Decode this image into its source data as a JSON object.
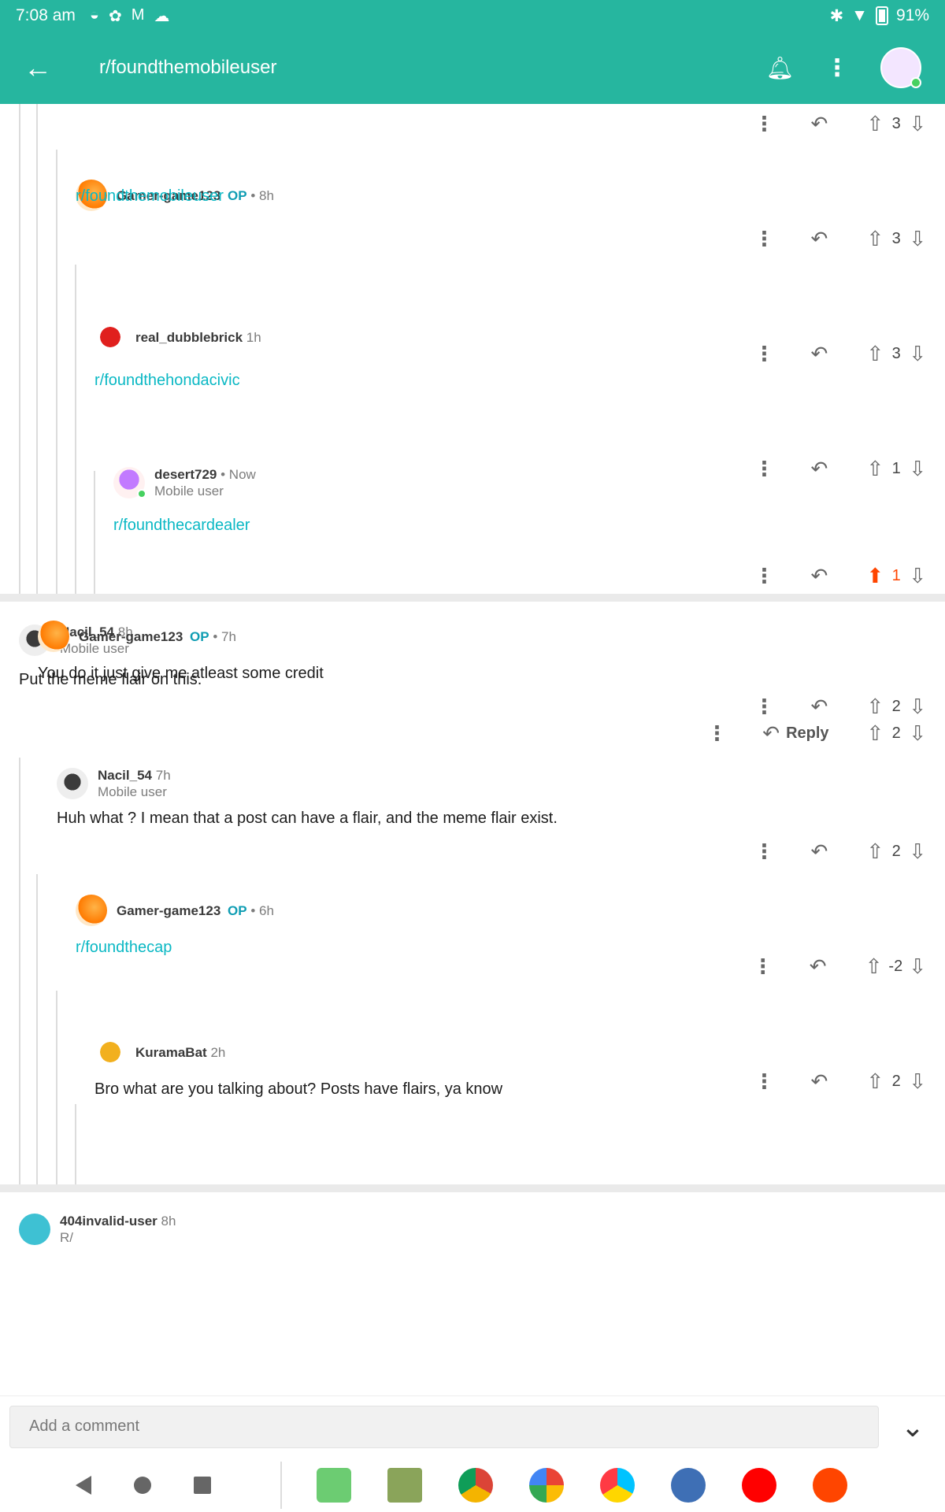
{
  "status_bar": {
    "time": "7:08 am",
    "battery": "91%",
    "icons": [
      "food-icon",
      "ip-icon",
      "gmail-icon",
      "cloud-icon",
      "bluetooth-icon",
      "wifi-icon"
    ]
  },
  "header": {
    "title": "r/foundthemobileuser",
    "back_icon": "back-arrow-icon"
  },
  "reply_label": "Reply",
  "comments": [
    {
      "user": "Gamer-game123",
      "op": "OP",
      "time": "• 8h",
      "flair": "",
      "body": "r/foundthemobileuser",
      "score": "3",
      "link": true
    },
    {
      "user": "real_dubblebrick",
      "op": "",
      "time": "1h",
      "flair": "",
      "body": "r/foundthehondacivic",
      "score": "1",
      "link": true
    },
    {
      "user": "desert729",
      "op": "",
      "time": "• Now",
      "flair": "Mobile user",
      "body": "r/foundthecardealer",
      "score": "1",
      "link": true,
      "upvoted": true
    },
    {
      "user": "Nacil_54",
      "op": "",
      "time": "8h",
      "flair": "Mobile user",
      "body": "Put the meme flair on this.",
      "score": "2",
      "link": false
    },
    {
      "user": "Gamer-game123",
      "op": "OP",
      "time": "• 7h",
      "flair": "",
      "body": "You do it just give me atleast some credit",
      "score": "2",
      "link": false
    },
    {
      "user": "Nacil_54",
      "op": "",
      "time": "7h",
      "flair": "Mobile user",
      "body": "Huh what ? I mean that a post can have a flair, and the meme flair exist.",
      "score": "2",
      "link": false
    },
    {
      "user": "Gamer-game123",
      "op": "OP",
      "time": "• 6h",
      "flair": "",
      "body": "r/foundthecap",
      "score": "-2",
      "link": true
    },
    {
      "user": "KuramaBat",
      "op": "",
      "time": "2h",
      "flair": "",
      "body": "Bro what are you talking about? Posts have flairs, ya know",
      "score": "2",
      "link": false
    },
    {
      "user": "404invalid-user",
      "op": "",
      "time": "8h",
      "flair": "R/",
      "body": "",
      "score": "",
      "link": false
    }
  ],
  "top_partial": {
    "score": "3"
  },
  "composer": {
    "placeholder": "Add a comment"
  },
  "colors": {
    "accent": "#26b69f",
    "link": "#0ab8c4",
    "op": "#0f9db3",
    "upvote": "#ff4500"
  }
}
